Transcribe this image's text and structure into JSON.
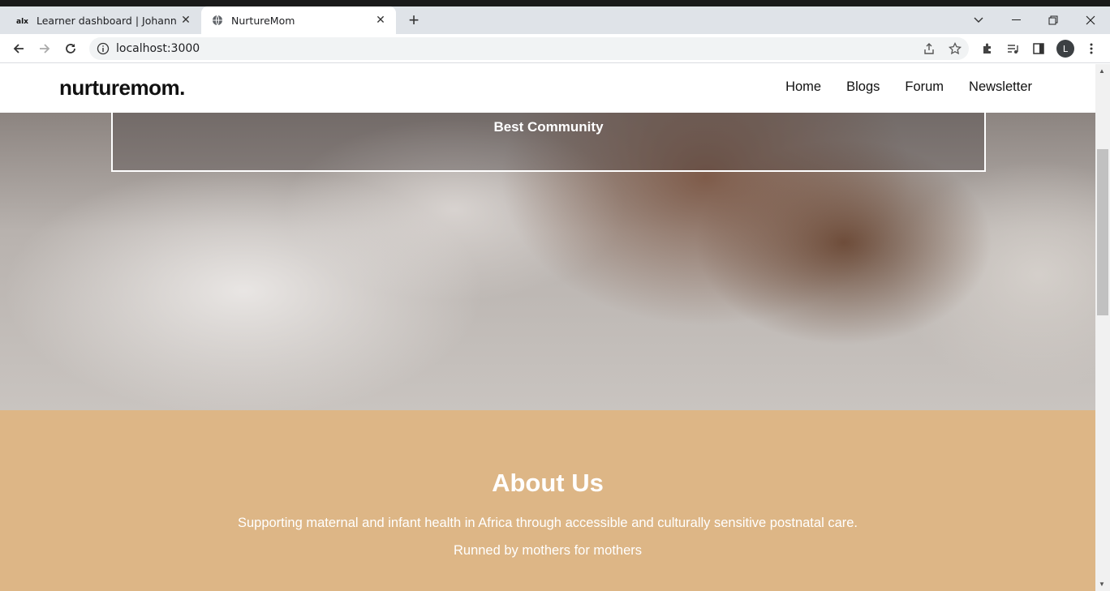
{
  "browser": {
    "tabs": [
      {
        "title": "Learner dashboard | Johannesburg",
        "favicon": "alx-logo-icon",
        "active": false
      },
      {
        "title": "NurtureMom",
        "favicon": "globe-icon",
        "active": true
      }
    ],
    "url": "localhost:3000",
    "profile_initial": "L"
  },
  "site": {
    "logo": "nurturemom.",
    "nav": [
      "Home",
      "Blogs",
      "Forum",
      "Newsletter"
    ]
  },
  "hero": {
    "heading": "Best Community"
  },
  "about": {
    "title": "About Us",
    "line1": "Supporting maternal and infant health in Africa through accessible and culturally sensitive postnatal care.",
    "line2": "Runned by mothers for mothers"
  },
  "colors": {
    "about_bg": "#ddb686",
    "tabstrip_bg": "#dfe3e8"
  }
}
